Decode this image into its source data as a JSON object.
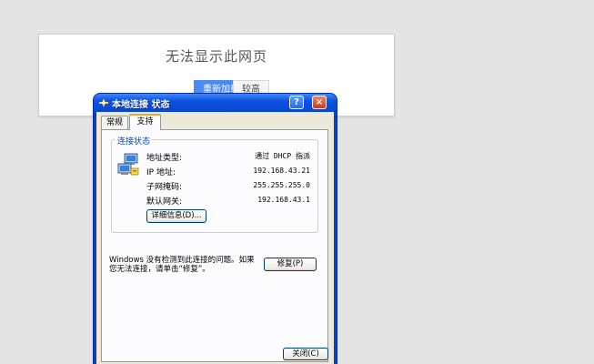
{
  "browser_error": {
    "title": "无法显示此网页",
    "reload_label": "重新加载",
    "more_label": "较高"
  },
  "dialog": {
    "title": "本地连接 状态",
    "help_glyph": "?",
    "close_glyph": "×",
    "tabs": [
      {
        "label": "常规",
        "selected": false
      },
      {
        "label": "支持",
        "selected": true
      }
    ],
    "group_title": "连接状态",
    "rows": [
      {
        "label": "地址类型:",
        "value": "通过 DHCP 指派"
      },
      {
        "label": "IP 地址:",
        "value": "192.168.43.21"
      },
      {
        "label": "子网掩码:",
        "value": "255.255.255.0"
      },
      {
        "label": "默认网关:",
        "value": "192.168.43.1"
      }
    ],
    "details_label": "详细信息(D)...",
    "diag_text": "Windows 没有检测到此连接的问题。如果您无法连接，请单击“修复”。",
    "repair_label": "修复(P)",
    "close_label": "关闭(C)"
  },
  "colors": {
    "accent_blue": "#4a8af4",
    "xp_title_blue": "#0b52e0",
    "xp_face": "#ece9d8",
    "tab_highlight": "#f3a33b"
  },
  "icons": {
    "title": "network-connection-icon",
    "status": "network-computers-icon"
  }
}
